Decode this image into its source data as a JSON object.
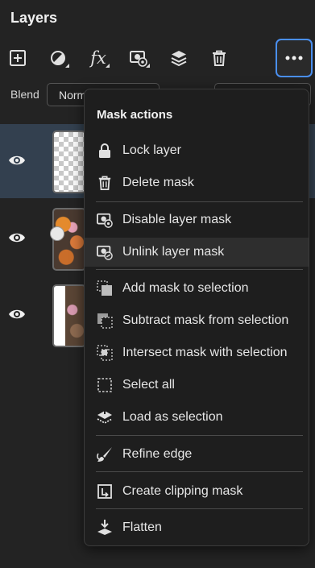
{
  "panel": {
    "title": "Layers"
  },
  "toolbar": {
    "tools": [
      {
        "name": "add-layer-icon"
      },
      {
        "name": "adjustment-icon"
      },
      {
        "name": "fx-icon",
        "label": "fx"
      },
      {
        "name": "mask-icon"
      },
      {
        "name": "layers-stack-icon"
      },
      {
        "name": "trash-icon"
      }
    ],
    "more": {
      "name": "more-options-icon"
    }
  },
  "blend": {
    "label": "Blend",
    "value": "Normal"
  },
  "layers": [
    {
      "selected": true,
      "thumb": "transparent"
    },
    {
      "selected": false,
      "thumb": "photo-donuts"
    },
    {
      "selected": false,
      "thumb": "photo-masked"
    }
  ],
  "menu": {
    "title": "Mask actions",
    "items": [
      {
        "label": "Lock layer",
        "icon": "lock-icon"
      },
      {
        "label": "Delete mask",
        "icon": "trash-icon"
      },
      {
        "label": "Disable layer mask",
        "icon": "mask-disable-icon"
      },
      {
        "label": "Unlink layer mask",
        "icon": "unlink-icon"
      },
      {
        "label": "Add mask to selection",
        "icon": "add-selection-icon"
      },
      {
        "label": "Subtract mask from selection",
        "icon": "subtract-selection-icon"
      },
      {
        "label": "Intersect mask with selection",
        "icon": "intersect-selection-icon"
      },
      {
        "label": "Select all",
        "icon": "select-all-icon"
      },
      {
        "label": "Load as selection",
        "icon": "load-selection-icon"
      },
      {
        "label": "Refine edge",
        "icon": "brush-icon"
      },
      {
        "label": "Create clipping mask",
        "icon": "clipping-mask-icon"
      },
      {
        "label": "Flatten",
        "icon": "flatten-icon"
      }
    ]
  },
  "colors": {
    "accent": "#4a8ff0",
    "selected_row": "#33404f",
    "background": "#232323"
  }
}
